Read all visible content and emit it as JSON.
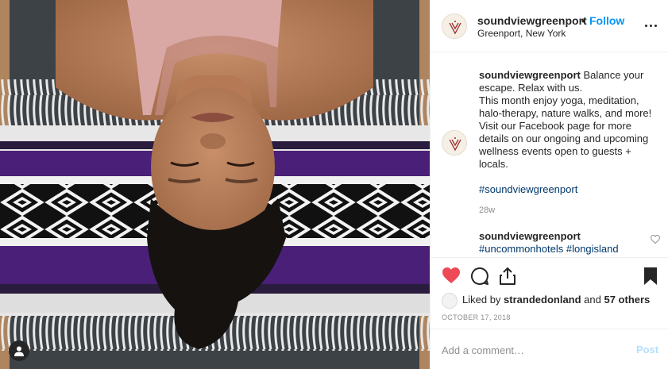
{
  "post": {
    "username": "soundviewgreenport",
    "separator": "•",
    "follow_label": "Follow",
    "location": "Greenport, New York",
    "caption_text": " Balance your escape. Relax with us.\nThis month enjoy yoga, meditation, halo-therapy, nature walks, and more! Visit our Facebook page for more details on our ongoing and upcoming wellness events open to guests + locals.",
    "hashtag": "#soundviewgreenport",
    "time_ago": "28w"
  },
  "comment": {
    "username": "soundviewgreenport",
    "text": "#uncommonhotels #longisland"
  },
  "engagement": {
    "liked_by_prefix": "Liked by ",
    "liked_by_user": "strandedonland",
    "liked_by_suffix": " and ",
    "others": "57 others",
    "date": "OCTOBER 17, 2018"
  },
  "composer": {
    "placeholder": "Add a comment…",
    "post_label": "Post"
  },
  "icons": {
    "like": "heart-icon",
    "comment": "speech-bubble-icon",
    "share": "share-icon",
    "save": "bookmark-icon",
    "more": "more-options-icon",
    "user_tag": "user-tag-icon"
  },
  "colors": {
    "accent_blue": "#0095f6",
    "like_red": "#ed4956",
    "hashtag_blue": "#00376b",
    "muted_gray": "#8e8e8e",
    "post_disabled": "#b2dffc",
    "blanket_purple": "#4a1f78"
  }
}
